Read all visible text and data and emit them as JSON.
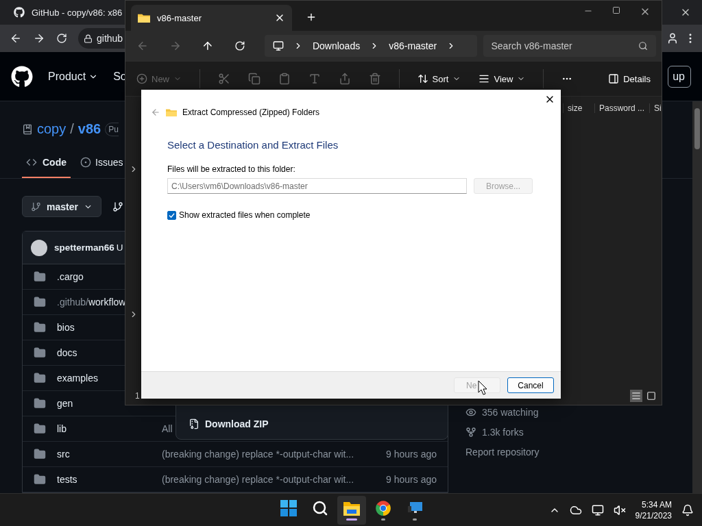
{
  "browser": {
    "tab_title": "GitHub - copy/v86: x86",
    "address": "github"
  },
  "github": {
    "nav": [
      {
        "label": "Product",
        "dropdown": true
      },
      {
        "label": "So",
        "dropdown": false
      }
    ],
    "sign_up": "up",
    "repo": {
      "owner": "copy",
      "separator": "/",
      "name": "v86",
      "visibility": "Pu"
    },
    "tabs": [
      {
        "label": "Code",
        "selected": true,
        "kind": "code"
      },
      {
        "label": "Issues",
        "selected": false,
        "kind": "issues"
      }
    ],
    "branch": "master",
    "commit": {
      "author": "spetterman66",
      "rest": "U"
    },
    "files": [
      {
        "name": ".cargo"
      },
      {
        "prefix": ".github/",
        "name": "workflow"
      },
      {
        "name": "bios"
      },
      {
        "name": "docs"
      },
      {
        "name": "examples"
      },
      {
        "name": "gen"
      },
      {
        "name": "lib",
        "message": "All"
      },
      {
        "name": "src",
        "message": "(breaking change) replace *-output-char wit...",
        "time": "9 hours ago"
      },
      {
        "name": "tests",
        "message": "(breaking change) replace *-output-char wit...",
        "time": "9 hours ago"
      }
    ],
    "sidebar": [
      {
        "kind": "watching",
        "text": "356 watching"
      },
      {
        "kind": "forks",
        "text": "1.3k forks"
      },
      {
        "kind": "report",
        "text": "Report repository"
      }
    ],
    "download_menu": {
      "label": "Download ZIP"
    }
  },
  "explorer": {
    "tab_title": "v86-master",
    "breadcrumb": [
      "Downloads",
      "v86-master"
    ],
    "search_placeholder": "Search v86-master",
    "toolbar": [
      {
        "kind": "new",
        "label": "New",
        "disabled": true
      },
      {
        "kind": "sort",
        "label": "Sort",
        "disabled": false
      },
      {
        "kind": "view",
        "label": "View",
        "disabled": false
      }
    ],
    "details": "Details",
    "columns": [
      "size",
      "Password ...",
      "Si"
    ],
    "status": "1",
    "view_modes": [
      {
        "kind": "details",
        "selected": true
      },
      {
        "kind": "tiles",
        "selected": false
      }
    ]
  },
  "dialog": {
    "title": "Extract Compressed (Zipped) Folders",
    "heading": "Select a Destination and Extract Files",
    "field_label": "Files will be extracted to this folder:",
    "path": "C:\\Users\\vm6\\Downloads\\v86-master",
    "browse": {
      "label": "Browse...",
      "disabled": true
    },
    "show_files": {
      "label": "Show extracted files when complete",
      "checked": true
    },
    "buttons": [
      {
        "label": "Ne",
        "disabled": true,
        "default": false
      },
      {
        "label": "Cancel",
        "disabled": false,
        "default": true
      }
    ]
  },
  "taskbar": {
    "apps": [
      {
        "kind": "start",
        "active": false,
        "running": false
      },
      {
        "kind": "search",
        "active": false,
        "running": false
      },
      {
        "kind": "explorer",
        "active": true,
        "running": true
      },
      {
        "kind": "chrome",
        "active": false,
        "running": true
      },
      {
        "kind": "remote",
        "active": false,
        "running": true
      }
    ],
    "time": "5:34 AM",
    "date": "9/21/2023"
  }
}
